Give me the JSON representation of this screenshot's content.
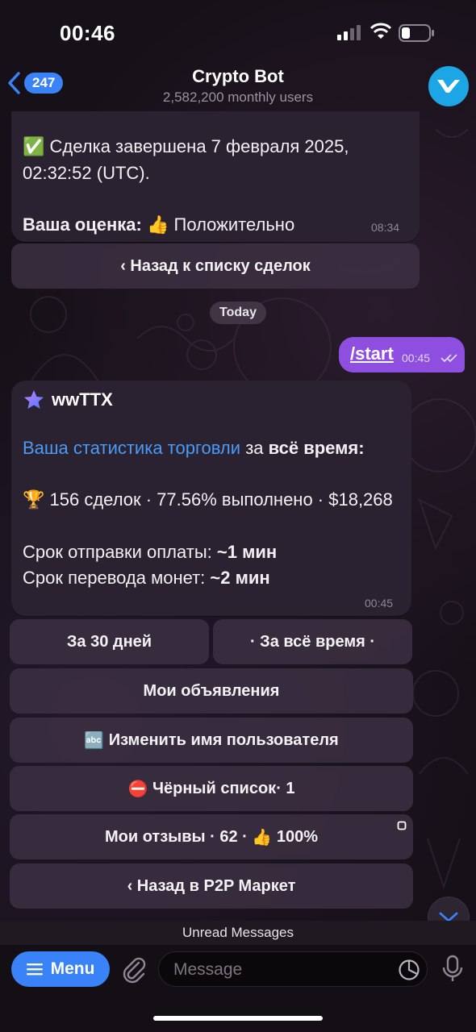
{
  "status_bar": {
    "time": "00:46"
  },
  "header": {
    "back_badge": "247",
    "title": "Crypto Bot",
    "subtitle": "2,582,200 monthly users"
  },
  "message1": {
    "line1_icon": "✅",
    "line1": "Сделка завершена 7 февраля 2025, 02:32:52 (UTC).",
    "rating_label": "Ваша оценка:",
    "rating_icon": "👍",
    "rating_value": "Положительно",
    "time": "08:34"
  },
  "buttons1": {
    "back_to_deals": "‹ Назад к списку сделок"
  },
  "date_separator": "Today",
  "outgoing": {
    "text": "/start",
    "time": "00:45"
  },
  "message2": {
    "name": "wwTTX",
    "stats_link": "Ваша статистика торговли",
    "stats_for": "за",
    "stats_period": "всё время:",
    "trophy_icon": "🏆",
    "stats_line": "156 сделок · 77.56% выполнено · $18,268",
    "pay_label": "Срок отправки оплаты:",
    "pay_value": "~1 мин",
    "transfer_label": "Срок перевода монет:",
    "transfer_value": "~2 мин",
    "time": "00:45"
  },
  "keyboard": {
    "btn_30_days": "За 30 дней",
    "btn_all_time": "· За всё время ·",
    "btn_my_ads": "Мои объявления",
    "btn_change_name_icon": "🔤",
    "btn_change_name": "Изменить имя пользователя",
    "btn_blacklist_icon": "⛔",
    "btn_blacklist": "Чёрный список· 1",
    "btn_reviews": "Мои отзывы · 62 ·",
    "btn_reviews_icon": "👍",
    "btn_reviews_pct": "100%",
    "btn_back_p2p": "‹ Назад в P2P Маркет"
  },
  "unread_label": "Unread Messages",
  "composer": {
    "menu_label": "Menu",
    "placeholder": "Message"
  },
  "colors": {
    "accent": "#3a82f7",
    "outgoing": "#8e4fe0",
    "link": "#4a9bf5"
  }
}
